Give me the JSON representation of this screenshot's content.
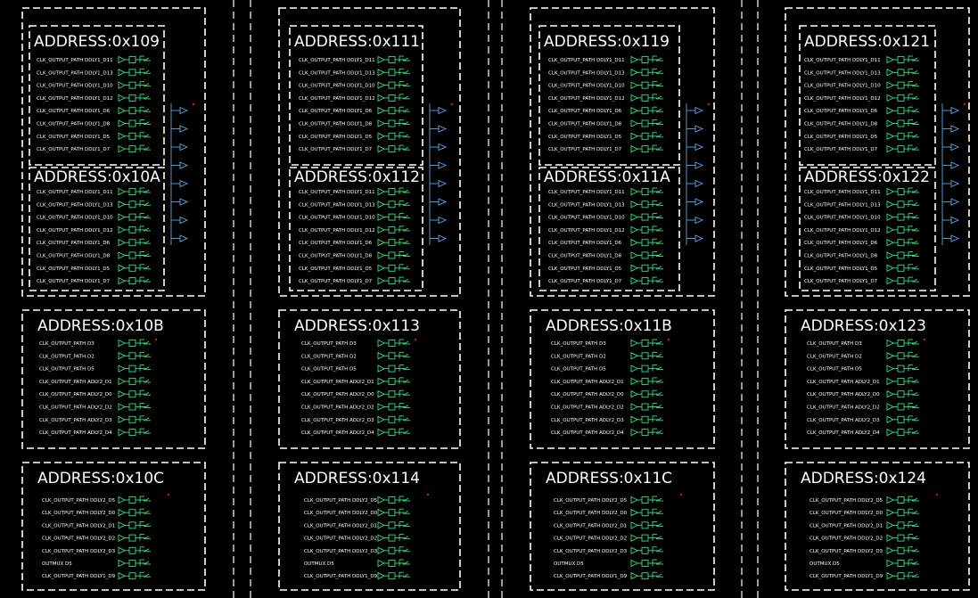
{
  "colors": {
    "background": "#000000",
    "border": "#ffffff",
    "gate": "#2fe08a",
    "wire": "#5aa8e6",
    "marker": "#d01818"
  },
  "columns": [
    {
      "top_blocks": [
        {
          "address": "ADDRESS:0x109",
          "rows": [
            "CLK_OUTPUT_PATH  DDLY1_D11",
            "CLK_OUTPUT_PATH  DDLY1_D13",
            "CLK_OUTPUT_PATH  DDLY1_D10",
            "CLK_OUTPUT_PATH  DDLY1_D12",
            "CLK_OUTPUT_PATH  DDLY1_D6",
            "CLK_OUTPUT_PATH  DDLY1_D8",
            "CLK_OUTPUT_PATH  DDLY1_D5",
            "CLK_OUTPUT_PATH  DDLY1_D7"
          ]
        },
        {
          "address": "ADDRESS:0x10A",
          "rows": [
            "CLK_OUTPUT_PATH  DDLY1_D11",
            "CLK_OUTPUT_PATH  DDLY1_D13",
            "CLK_OUTPUT_PATH  DDLY1_D10",
            "CLK_OUTPUT_PATH  DDLY1_D12",
            "CLK_OUTPUT_PATH  DDLY1_D6",
            "CLK_OUTPUT_PATH  DDLY1_D8",
            "CLK_OUTPUT_PATH  DDLY1_D5",
            "CLK_OUTPUT_PATH  DDLY1_D7"
          ]
        }
      ],
      "mid_block": {
        "address": "ADDRESS:0x10B",
        "rows": [
          "CLK_OUTPUT_PATH  D3",
          "CLK_OUTPUT_PATH  D2",
          "CLK_OUTPUT_PATH  D5",
          "CLK_OUTPUT_PATH  ADLY2_D1",
          "CLK_OUTPUT_PATH  ADLY2_D0",
          "CLK_OUTPUT_PATH  ADLY2_D2",
          "CLK_OUTPUT_PATH  ADLY2_D3",
          "CLK_OUTPUT_PATH  ADLY2_D4"
        ]
      },
      "bot_block": {
        "address": "ADDRESS:0x10C",
        "rows": [
          "CLK_OUTPUT_PATH  DDLY2_D5",
          "CLK_OUTPUT_PATH  DDLY2_D0",
          "CLK_OUTPUT_PATH  DDLY2_D1",
          "CLK_OUTPUT_PATH  DDLY2_D2",
          "CLK_OUTPUT_PATH  DDLY2_D3",
          "OUTMUX D5",
          "CLK_OUTPUT_PATH  DDLY1_D9"
        ]
      }
    },
    {
      "top_blocks": [
        {
          "address": "ADDRESS:0x111",
          "rows": [
            "CLK_OUTPUT_PATH  DDLY1_D11",
            "CLK_OUTPUT_PATH  DDLY1_D13",
            "CLK_OUTPUT_PATH  DDLY1_D10",
            "CLK_OUTPUT_PATH  DDLY1_D12",
            "CLK_OUTPUT_PATH  DDLY1_D6",
            "CLK_OUTPUT_PATH  DDLY1_D8",
            "CLK_OUTPUT_PATH  DDLY1_D5",
            "CLK_OUTPUT_PATH  DDLY1_D7"
          ]
        },
        {
          "address": "ADDRESS:0x112",
          "rows": [
            "CLK_OUTPUT_PATH  DDLY1_D11",
            "CLK_OUTPUT_PATH  DDLY1_D13",
            "CLK_OUTPUT_PATH  DDLY1_D10",
            "CLK_OUTPUT_PATH  DDLY1_D12",
            "CLK_OUTPUT_PATH  DDLY1_D6",
            "CLK_OUTPUT_PATH  DDLY1_D8",
            "CLK_OUTPUT_PATH  DDLY1_D5",
            "CLK_OUTPUT_PATH  DDLY1_D7"
          ]
        }
      ],
      "mid_block": {
        "address": "ADDRESS:0x113",
        "rows": [
          "CLK_OUTPUT_PATH  D3",
          "CLK_OUTPUT_PATH  D2",
          "CLK_OUTPUT_PATH  D5",
          "CLK_OUTPUT_PATH  ADLY2_D1",
          "CLK_OUTPUT_PATH  ADLY2_D0",
          "CLK_OUTPUT_PATH  ADLY2_D2",
          "CLK_OUTPUT_PATH  ADLY2_D3",
          "CLK_OUTPUT_PATH  ADLY2_D4"
        ]
      },
      "bot_block": {
        "address": "ADDRESS:0x114",
        "rows": [
          "CLK_OUTPUT_PATH  DDLY2_D5",
          "CLK_OUTPUT_PATH  DDLY2_D0",
          "CLK_OUTPUT_PATH  DDLY2_D1",
          "CLK_OUTPUT_PATH  DDLY2_D2",
          "CLK_OUTPUT_PATH  DDLY2_D3",
          "OUTMUX D5",
          "CLK_OUTPUT_PATH  DDLY1_D9"
        ]
      }
    },
    {
      "top_blocks": [
        {
          "address": "ADDRESS:0x119",
          "rows": [
            "CLK_OUTPUT_PATH  DDLY1_D11",
            "CLK_OUTPUT_PATH  DDLY1_D13",
            "CLK_OUTPUT_PATH  DDLY1_D10",
            "CLK_OUTPUT_PATH  DDLY1_D12",
            "CLK_OUTPUT_PATH  DDLY1_D6",
            "CLK_OUTPUT_PATH  DDLY1_D8",
            "CLK_OUTPUT_PATH  DDLY1_D5",
            "CLK_OUTPUT_PATH  DDLY1_D7"
          ]
        },
        {
          "address": "ADDRESS:0x11A",
          "rows": [
            "CLK_OUTPUT_PATH  DDLY1_D11",
            "CLK_OUTPUT_PATH  DDLY1_D13",
            "CLK_OUTPUT_PATH  DDLY1_D10",
            "CLK_OUTPUT_PATH  DDLY1_D12",
            "CLK_OUTPUT_PATH  DDLY1_D6",
            "CLK_OUTPUT_PATH  DDLY1_D8",
            "CLK_OUTPUT_PATH  DDLY1_D5",
            "CLK_OUTPUT_PATH  DDLY1_D7"
          ]
        }
      ],
      "mid_block": {
        "address": "ADDRESS:0x11B",
        "rows": [
          "CLK_OUTPUT_PATH  D3",
          "CLK_OUTPUT_PATH  D2",
          "CLK_OUTPUT_PATH  D5",
          "CLK_OUTPUT_PATH  ADLY2_D1",
          "CLK_OUTPUT_PATH  ADLY2_D0",
          "CLK_OUTPUT_PATH  ADLY2_D2",
          "CLK_OUTPUT_PATH  ADLY2_D3",
          "CLK_OUTPUT_PATH  ADLY2_D4"
        ]
      },
      "bot_block": {
        "address": "ADDRESS:0x11C",
        "rows": [
          "CLK_OUTPUT_PATH  DDLY2_D5",
          "CLK_OUTPUT_PATH  DDLY2_D0",
          "CLK_OUTPUT_PATH  DDLY2_D1",
          "CLK_OUTPUT_PATH  DDLY2_D2",
          "CLK_OUTPUT_PATH  DDLY2_D3",
          "OUTMUX D5",
          "CLK_OUTPUT_PATH  DDLY1_D9"
        ]
      }
    },
    {
      "top_blocks": [
        {
          "address": "ADDRESS:0x121",
          "rows": [
            "CLK_OUTPUT_PATH  DDLY1_D11",
            "CLK_OUTPUT_PATH  DDLY1_D13",
            "CLK_OUTPUT_PATH  DDLY1_D10",
            "CLK_OUTPUT_PATH  DDLY1_D12",
            "CLK_OUTPUT_PATH  DDLY1_D6",
            "CLK_OUTPUT_PATH  DDLY1_D8",
            "CLK_OUTPUT_PATH  DDLY1_D5",
            "CLK_OUTPUT_PATH  DDLY1_D7"
          ]
        },
        {
          "address": "ADDRESS:0x122",
          "rows": [
            "CLK_OUTPUT_PATH  DDLY1_D11",
            "CLK_OUTPUT_PATH  DDLY1_D13",
            "CLK_OUTPUT_PATH  DDLY1_D10",
            "CLK_OUTPUT_PATH  DDLY1_D12",
            "CLK_OUTPUT_PATH  DDLY1_D6",
            "CLK_OUTPUT_PATH  DDLY1_D8",
            "CLK_OUTPUT_PATH  DDLY1_D5",
            "CLK_OUTPUT_PATH  DDLY1_D7"
          ]
        }
      ],
      "mid_block": {
        "address": "ADDRESS:0x123",
        "rows": [
          "CLK_OUTPUT_PATH  D3",
          "CLK_OUTPUT_PATH  D2",
          "CLK_OUTPUT_PATH  D5",
          "CLK_OUTPUT_PATH  ADLY2_D1",
          "CLK_OUTPUT_PATH  ADLY2_D0",
          "CLK_OUTPUT_PATH  ADLY2_D2",
          "CLK_OUTPUT_PATH  ADLY2_D3",
          "CLK_OUTPUT_PATH  ADLY2_D4"
        ]
      },
      "bot_block": {
        "address": "ADDRESS:0x124",
        "rows": [
          "CLK_OUTPUT_PATH  DDLY2_D5",
          "CLK_OUTPUT_PATH  DDLY2_D0",
          "CLK_OUTPUT_PATH  DDLY2_D1",
          "CLK_OUTPUT_PATH  DDLY2_D2",
          "CLK_OUTPUT_PATH  DDLY2_D3",
          "OUTMUX D5",
          "CLK_OUTPUT_PATH  DDLY1_D9"
        ]
      }
    }
  ]
}
